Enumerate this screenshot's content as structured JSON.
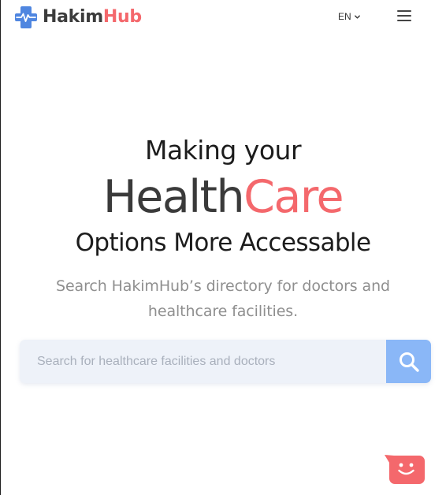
{
  "header": {
    "logo": {
      "name_part1": "Hakim",
      "name_part2": "Hub",
      "icon": "medical-cross-heartbeat-icon"
    },
    "language": {
      "label": "EN",
      "icon": "chevron-down-icon"
    },
    "menu_icon": "hamburger-menu-icon"
  },
  "hero": {
    "line1": "Making your",
    "line2_part1": "Health",
    "line2_part2": "Care",
    "line3": "Options More Accessable",
    "subtitle": "Search HakimHub’s directory for doctors and healthcare facilities."
  },
  "search": {
    "placeholder": "Search for healthcare facilities and doctors",
    "value": "",
    "button_icon": "search-icon"
  },
  "chat_widget": {
    "icon": "smiley-chat-icon"
  },
  "colors": {
    "brand_red": "#f4686c",
    "brand_dark": "#3a3a3a",
    "logo_blue": "#4f86e0",
    "search_button": "#8ab7f7",
    "search_bg": "#eef2f9",
    "subtitle_gray": "#8f8f8f"
  }
}
